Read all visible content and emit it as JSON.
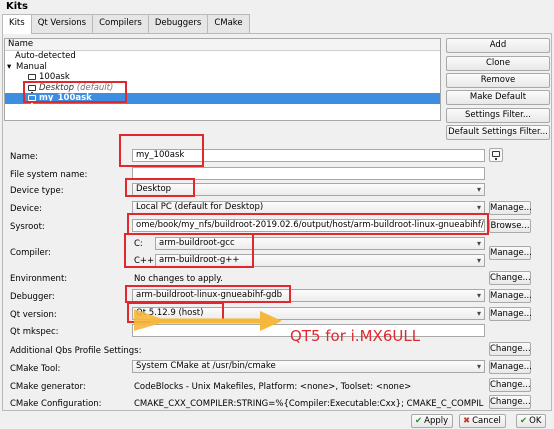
{
  "window": {
    "title": "Kits"
  },
  "tabs": [
    {
      "label": "Kits",
      "active": true
    },
    {
      "label": "Qt Versions"
    },
    {
      "label": "Compilers"
    },
    {
      "label": "Debuggers"
    },
    {
      "label": "CMake"
    }
  ],
  "tree": {
    "header": "Name",
    "auto_detected": "Auto-detected",
    "manual_arrow": "▾",
    "manual": "Manual",
    "items": [
      {
        "label": "100ask",
        "suffix": ""
      },
      {
        "label": "Desktop",
        "suffix": "(default)"
      },
      {
        "label": "my_100ask",
        "suffix": "",
        "selected": true
      }
    ]
  },
  "side_buttons": [
    "Add",
    "Clone",
    "Remove",
    "Make Default",
    "Settings Filter...",
    "Default Settings Filter..."
  ],
  "form": {
    "name": {
      "label": "Name:",
      "value": "my_100ask"
    },
    "file_system_name": {
      "label": "File system name:",
      "value": ""
    },
    "device_type": {
      "label": "Device type:",
      "value": "Desktop"
    },
    "device": {
      "label": "Device:",
      "value": "Local PC (default for Desktop)",
      "button": "Manage..."
    },
    "sysroot": {
      "label": "Sysroot:",
      "value": "ome/book/my_nfs/buildroot-2019.02.6/output/host/arm-buildroot-linux-gnueabihf/sysroot",
      "button": "Browse..."
    },
    "compiler": {
      "label": "Compiler:",
      "c_label": "C:",
      "c_value": "arm-buildroot-gcc",
      "cpp_label": "C++:",
      "cpp_value": "arm-buildroot-g++",
      "button": "Manage..."
    },
    "environment": {
      "label": "Environment:",
      "value": "No changes to apply.",
      "button": "Change..."
    },
    "debugger": {
      "label": "Debugger:",
      "value": "arm-buildroot-linux-gnueabihf-gdb",
      "button": "Manage..."
    },
    "qt_version": {
      "label": "Qt version:",
      "value": "Qt 5.12.9 (host)",
      "button": "Manage..."
    },
    "qt_mkspec": {
      "label": "Qt mkspec:",
      "value": ""
    },
    "qbs": {
      "label": "Additional Qbs Profile Settings:",
      "button": "Change..."
    },
    "cmake_tool": {
      "label": "CMake Tool:",
      "value": "System CMake at /usr/bin/cmake",
      "button": "Manage..."
    },
    "cmake_generator": {
      "label": "CMake generator:",
      "value": "CodeBlocks - Unix Makefiles, Platform: <none>, Toolset: <none>",
      "button": "Change..."
    },
    "cmake_config": {
      "label": "CMake Configuration:",
      "value": "CMAKE_CXX_COMPILER:STRING=%{Compiler:Executable:Cxx}; CMAKE_C_COMPILER:STRI...",
      "button": "Change..."
    }
  },
  "annotation": "QT5 for i.MX6ULL",
  "bottom_buttons": {
    "apply": "Apply",
    "cancel": "Cancel",
    "ok": "OK"
  },
  "colors": {
    "selection": "#3d8ee0",
    "annotation_red": "#e0282d",
    "annotation_arrow": "#f5b83d"
  }
}
